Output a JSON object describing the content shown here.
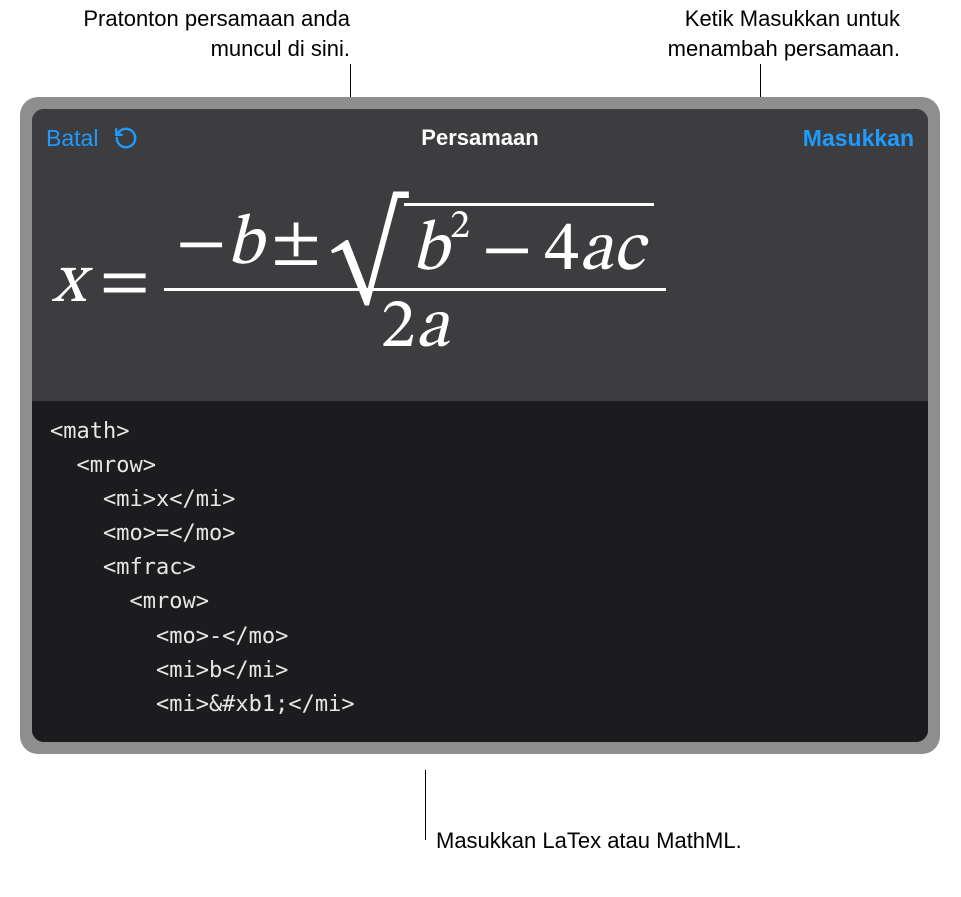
{
  "callouts": {
    "preview": "Pratonton persamaan\nanda muncul di sini.",
    "insert": "Ketik Masukkan untuk\nmenambah persamaan.",
    "input": "Masukkan LaTex atau\nMathML."
  },
  "header": {
    "cancel_label": "Batal",
    "title": "Persamaan",
    "insert_label": "Masukkan"
  },
  "icons": {
    "undo": "undo-icon"
  },
  "equation_preview": {
    "lhs": "x",
    "equals": "=",
    "numerator_minus": "−",
    "numerator_b": "b",
    "plus_minus": "±",
    "radicand_b": "b",
    "radicand_exp": "2",
    "radicand_minus": "−",
    "radicand_4": "4",
    "radicand_a": "a",
    "radicand_c": "c",
    "denominator_2": "2",
    "denominator_a": "a"
  },
  "code_input": "<math>\n  <mrow>\n    <mi>x</mi>\n    <mo>=</mo>\n    <mfrac>\n      <mrow>\n        <mo>-</mo>\n        <mi>b</mi>\n        <mi>&#xb1;</mi>"
}
